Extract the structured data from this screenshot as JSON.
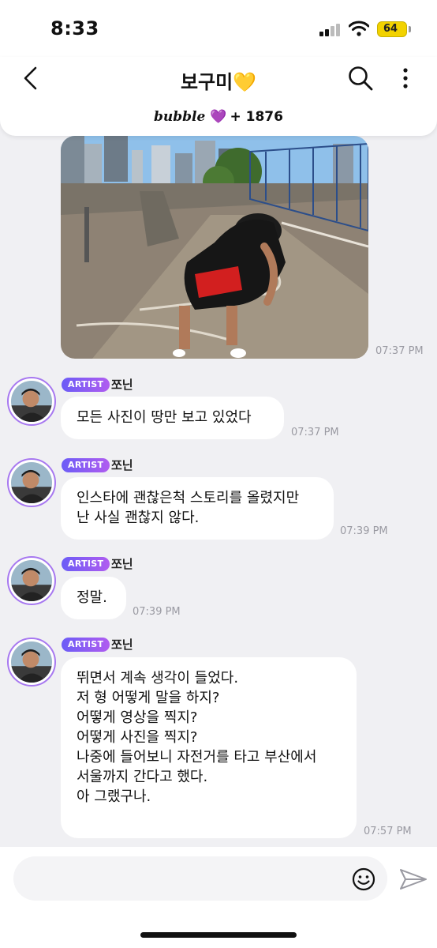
{
  "status": {
    "time": "8:33",
    "battery": "64"
  },
  "header": {
    "title": "보구미💛",
    "brand": "bubble",
    "heart": "💜",
    "count": "+ 1876"
  },
  "messages": [
    {
      "badge": "ARTIST",
      "name": "쪼닌",
      "text": "모든 사진이 땅만 보고 있었다",
      "time": "07:37 PM"
    },
    {
      "badge": "ARTIST",
      "name": "쪼닌",
      "text": "인스타에 괜찮은척 스토리를 올렸지만\n난 사실 괜찮지 않다.",
      "time": "07:39 PM"
    },
    {
      "badge": "ARTIST",
      "name": "쪼닌",
      "text": "정말.",
      "time": "07:39 PM"
    },
    {
      "badge": "ARTIST",
      "name": "쪼닌",
      "text": "뛰면서 계속 생각이 들었다.\n저 형 어떻게 말을 하지?\n어떻게 영상을 찍지?\n어떻게 사진을 찍지?\n나중에 들어보니 자전거를 타고 부산에서\n서울까지 간다고 했다.\n아 그랬구나.",
      "time": "07:57 PM"
    }
  ],
  "photo_time": "07:37 PM",
  "icons": {
    "back": "chevron-left-icon",
    "search": "search-icon",
    "more": "more-vertical-icon",
    "emoji": "smiley-icon",
    "send": "paper-plane-icon"
  },
  "colors": {
    "accent": "#8b5cf6",
    "chat_bg": "#f0f0f3"
  }
}
